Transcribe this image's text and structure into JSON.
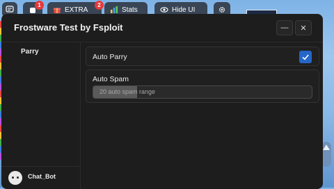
{
  "topbar": {
    "extra_label": "EXTRA",
    "extra_badge": "1",
    "extra2_badge": "2",
    "stats_label": "Stats",
    "hide_ui_label": "Hide UI"
  },
  "window": {
    "title": "Frostware Test by Fsploit",
    "minimize_glyph": "—",
    "close_glyph": "✕"
  },
  "sidebar": {
    "items": [
      {
        "label": "Parry"
      }
    ],
    "user": {
      "name": "Chat_Bot"
    }
  },
  "main": {
    "auto_parry": {
      "label": "Auto Parry",
      "checked": true
    },
    "auto_spam": {
      "label": "Auto Spam",
      "slider_text": "20 auto spam range",
      "fill_fraction": 0.2
    }
  },
  "colors": {
    "accent": "#2566c7",
    "window_bg": "#1d1d1d"
  }
}
